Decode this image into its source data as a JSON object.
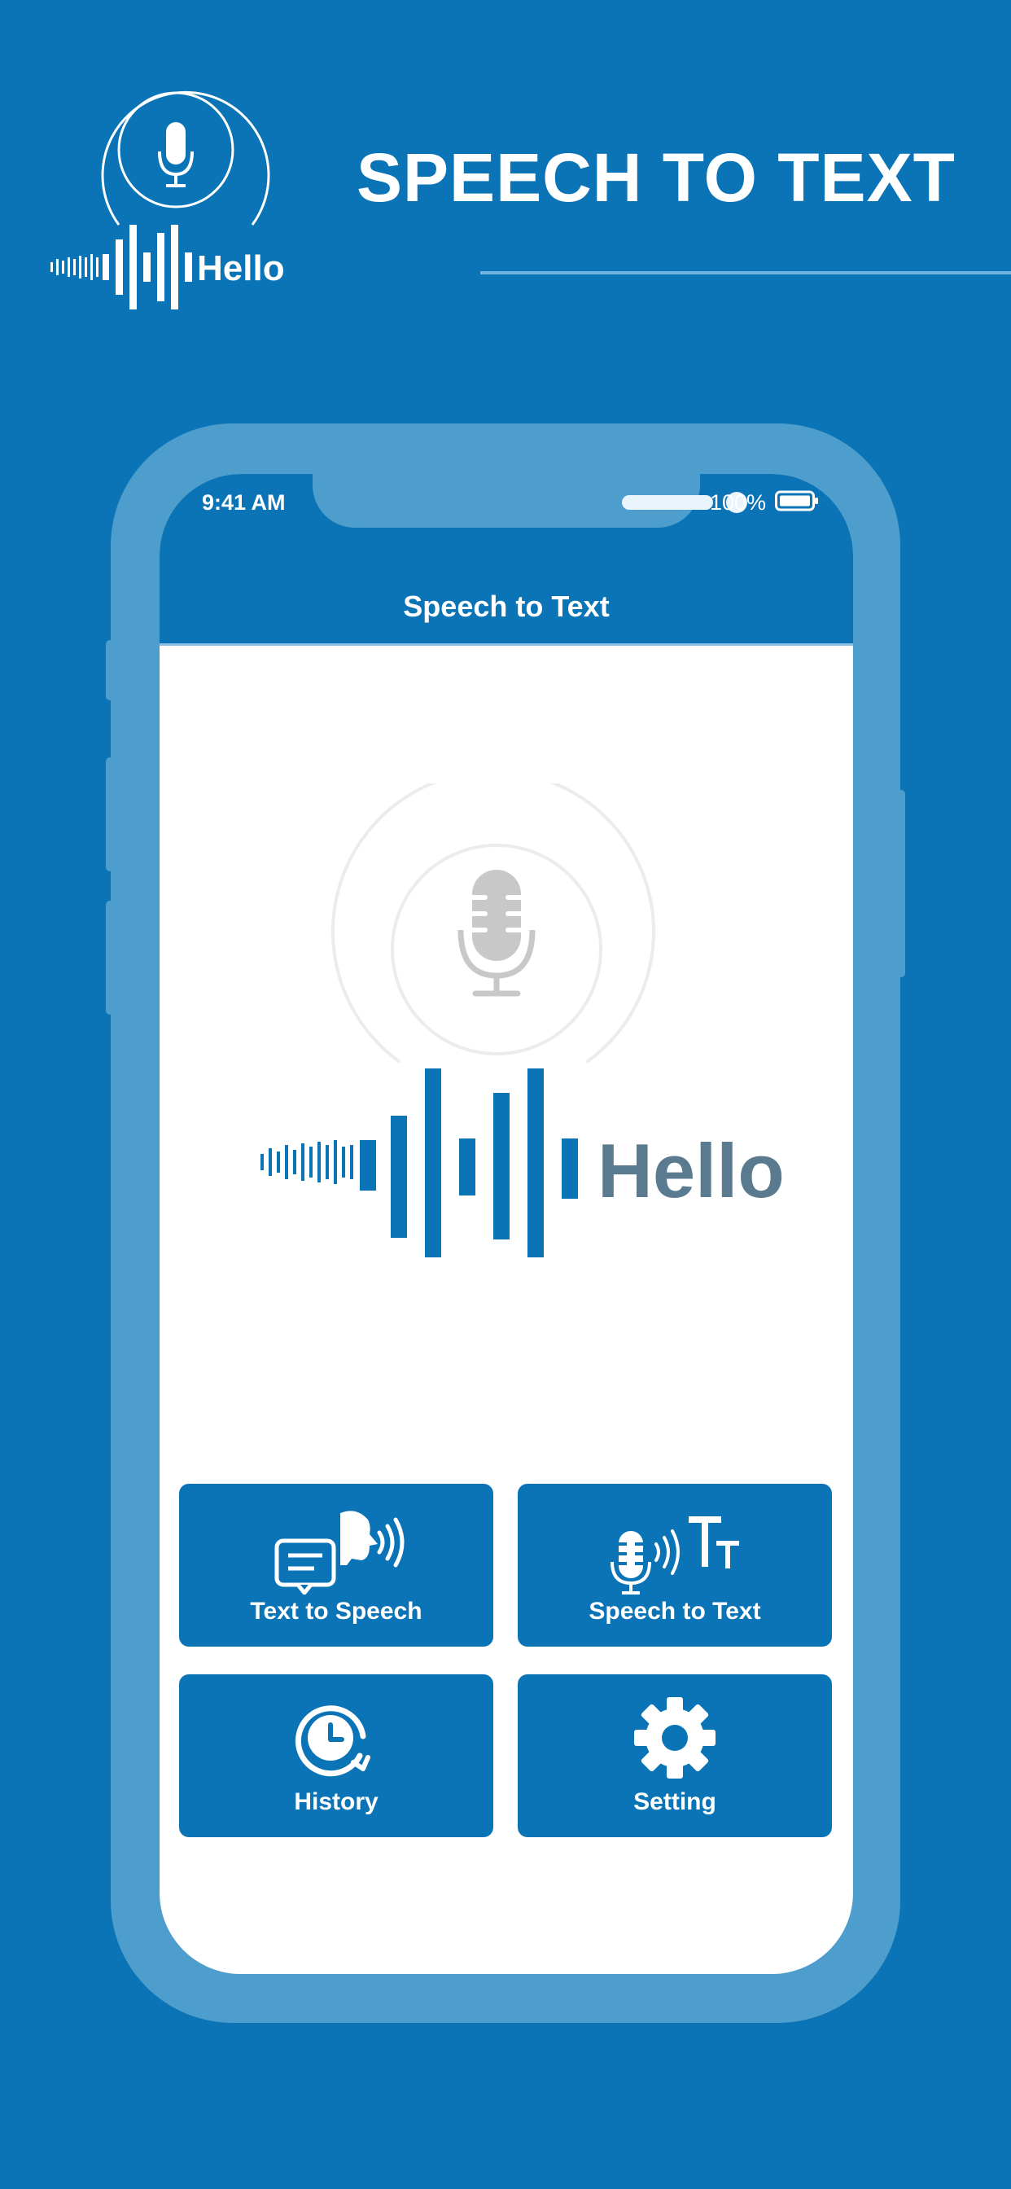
{
  "promo": {
    "logo_text": "Hello",
    "headline": "SPEECH TO TEXT"
  },
  "status_bar": {
    "time": "9:41 AM",
    "battery": "100%"
  },
  "app": {
    "title": "Speech to Text",
    "hero_word": "Hello"
  },
  "tiles": [
    {
      "label": "Text to Speech",
      "icon": "text-to-speech-icon"
    },
    {
      "label": "Speech to Text",
      "icon": "speech-to-text-icon"
    },
    {
      "label": "History",
      "icon": "history-icon"
    },
    {
      "label": "Setting",
      "icon": "gear-icon"
    }
  ],
  "colors": {
    "background": "#0B74B6",
    "phone_frame": "#4D9DCD",
    "screen": "#FFFFFF",
    "hero_wave": "#0B74B6",
    "hero_word": "#5A7A90",
    "mic_gray": "#C8C8C8"
  }
}
